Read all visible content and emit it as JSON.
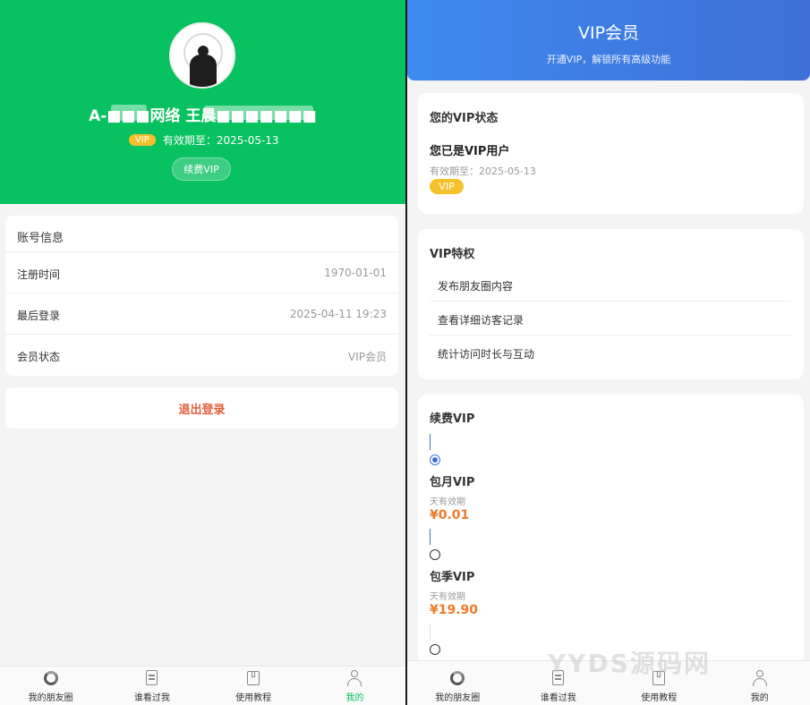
{
  "left": {
    "profile": {
      "username": "A-■■■网络 王晨■■■■■■■",
      "vip_badge": "VIP",
      "expiry": "有效期至：2025-05-13",
      "renew_button": "续费VIP"
    },
    "info": {
      "title": "账号信息",
      "rows": [
        {
          "label": "注册时间",
          "value": "1970-01-01"
        },
        {
          "label": "最后登录",
          "value": "2025-04-11 19:23"
        },
        {
          "label": "会员状态",
          "value": "VIP会员"
        }
      ]
    },
    "logout": "退出登录",
    "tabs": [
      {
        "label": "我的朋友圈",
        "icon": "moments-icon"
      },
      {
        "label": "谁看过我",
        "icon": "visitors-icon"
      },
      {
        "label": "使用教程",
        "icon": "tutorial-icon"
      },
      {
        "label": "我的",
        "icon": "user-icon"
      }
    ]
  },
  "right": {
    "header": {
      "title": "VIP会员",
      "subtitle": "开通VIP，解锁所有高级功能"
    },
    "status": {
      "title": "您的VIP状态",
      "main": "您已是VIP用户",
      "expiry": "有效期至：2025-05-13",
      "badge": "VIP"
    },
    "privileges": {
      "title": "VIP特权",
      "items": [
        "发布朋友圈内容",
        "查看详细访客记录",
        "统计访问时长与互动"
      ]
    },
    "renew": {
      "title": "续费VIP",
      "plans": [
        {
          "name": "包月VIP",
          "days": "天有效期",
          "price": "¥0.01",
          "selected": true
        },
        {
          "name": "包季VIP",
          "days": "天有效期",
          "price": "¥19.90",
          "selected": false
        }
      ]
    },
    "tabs": [
      {
        "label": "我的朋友圈",
        "icon": "moments-icon"
      },
      {
        "label": "谁看过我",
        "icon": "visitors-icon"
      },
      {
        "label": "使用教程",
        "icon": "tutorial-icon"
      },
      {
        "label": "我的",
        "icon": "user-icon"
      }
    ]
  },
  "watermark": "YYDS源码网",
  "colors": {
    "primary_green": "#08c160",
    "vip_gold": "#f5c12a",
    "price_orange": "#f07a2a",
    "header_blue": "#3d8af0",
    "logout_red": "#e4603a"
  }
}
